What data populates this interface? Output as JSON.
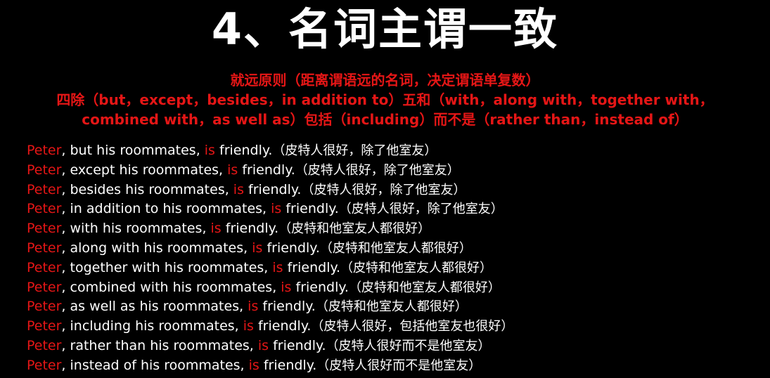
{
  "title": "4、名词主谓一致",
  "rules": {
    "line1": "就远原则（距离谓语远的名词，决定谓语单复数）",
    "line2": "四除（but，except，besides，in addition to）五和（with，along with，together with，",
    "line3": "combined with，as well as）包括（including）而不是（rather than，instead of）"
  },
  "examples": [
    {
      "subject": "Peter",
      "middle": ", but his roommates, ",
      "verb": "is",
      "predicate": " friendly.",
      "translation": "（皮特人很好，除了他室友）"
    },
    {
      "subject": "Peter",
      "middle": ", except his roommates, ",
      "verb": "is",
      "predicate": " friendly.",
      "translation": "（皮特人很好，除了他室友）"
    },
    {
      "subject": "Peter",
      "middle": ", besides his roommates, ",
      "verb": "is",
      "predicate": " friendly.",
      "translation": "（皮特人很好，除了他室友）"
    },
    {
      "subject": "Peter",
      "middle": ", in addition to his roommates, ",
      "verb": "is",
      "predicate": " friendly.",
      "translation": "（皮特人很好，除了他室友）"
    },
    {
      "subject": "Peter",
      "middle": ", with his roommates, ",
      "verb": "is",
      "predicate": " friendly.",
      "translation": "（皮特和他室友人都很好）"
    },
    {
      "subject": "Peter",
      "middle": ", along with his roommates, ",
      "verb": "is",
      "predicate": " friendly.",
      "translation": "（皮特和他室友人都很好）"
    },
    {
      "subject": "Peter",
      "middle": ", together with his roommates, ",
      "verb": "is",
      "predicate": " friendly.",
      "translation": "（皮特和他室友人都很好）"
    },
    {
      "subject": "Peter",
      "middle": ", combined with his roommates, ",
      "verb": "is",
      "predicate": " friendly.",
      "translation": "（皮特和他室友人都很好）"
    },
    {
      "subject": "Peter",
      "middle": ", as well as his roommates, ",
      "verb": "is",
      "predicate": " friendly.",
      "translation": "（皮特和他室友人都很好）"
    },
    {
      "subject": "Peter",
      "middle": ", including his roommates, ",
      "verb": "is",
      "predicate": " friendly.",
      "translation": "（皮特人很好，包括他室友也很好）"
    },
    {
      "subject": "Peter",
      "middle": ", rather than his roommates, ",
      "verb": "is",
      "predicate": " friendly.",
      "translation": "（皮特人很好而不是他室友）"
    },
    {
      "subject": "Peter",
      "middle": ", instead of his roommates, ",
      "verb": "is",
      "predicate": " friendly.",
      "translation": "（皮特人很好而不是他室友）"
    }
  ],
  "colors": {
    "background": "#000000",
    "text": "#ffffff",
    "highlight": "#e51616"
  }
}
